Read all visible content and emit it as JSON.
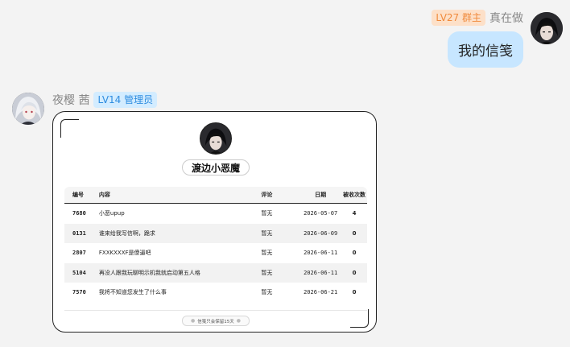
{
  "self_message": {
    "badge": "LV27 群主",
    "nickname": "真在做",
    "text": "我的信笺"
  },
  "other_message": {
    "nickname": "夜樱 茜",
    "badge": "LV14 管理员"
  },
  "card": {
    "username": "渡边小恶魔",
    "table": {
      "headers": [
        "编号",
        "内容",
        "评论",
        "日期",
        "被收次数"
      ],
      "rows": [
        {
          "id": "7680",
          "content": "小恶upup",
          "review": "暂无",
          "date": "2026-05-07",
          "count": "4"
        },
        {
          "id": "0131",
          "content": "谁来给我写信啊，跪求",
          "review": "暂无",
          "date": "2026-06-09",
          "count": "0"
        },
        {
          "id": "2807",
          "content": "FXXKXXXF是傻逼吧",
          "review": "暂无",
          "date": "2026-06-11",
          "count": "0"
        },
        {
          "id": "5104",
          "content": "再没人跟我玩聊明示机我就启动第五人格",
          "review": "暂无",
          "date": "2026-06-11",
          "count": "0"
        },
        {
          "id": "7570",
          "content": "我将不知道您发生了什么事",
          "review": "暂无",
          "date": "2026-06-21",
          "count": "0"
        }
      ]
    },
    "footer": "信笺只会保留15天"
  },
  "colors": {
    "background": "#f3f3f3",
    "self_bubble": "#c7e6ff",
    "owner_badge_bg": "#fde0c8",
    "owner_badge_text": "#f08a3c",
    "admin_badge_bg": "#d3ecff",
    "admin_badge_text": "#2f8de0"
  }
}
